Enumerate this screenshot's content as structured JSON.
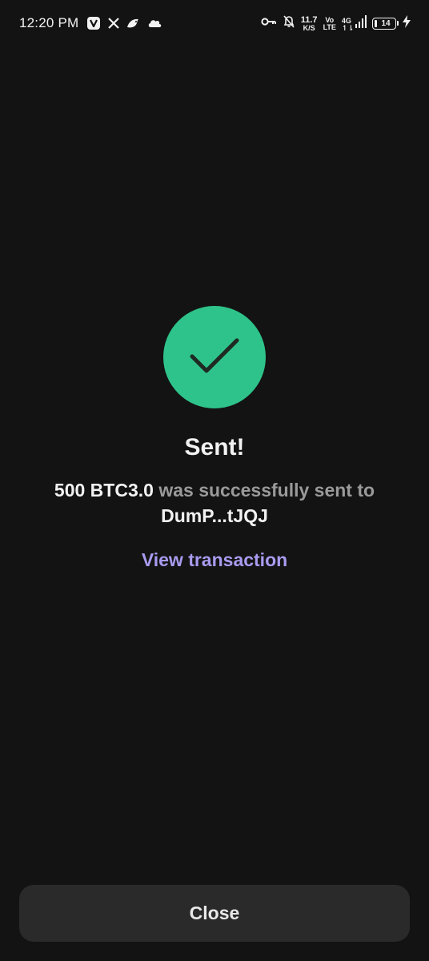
{
  "status_bar": {
    "time": "12:20 PM",
    "left_icons": [
      "vpn-v-icon",
      "x-icon",
      "bird-icon",
      "cloud-icon"
    ],
    "netspeed_value": "11.7",
    "netspeed_unit": "K/S",
    "volte_top": "Vo",
    "volte_bottom": "LTE",
    "network_gen": "4G",
    "battery_level": "14"
  },
  "result": {
    "icon": "checkmark-icon",
    "accent_color": "#2ec38a",
    "title": "Sent!",
    "amount": "500 BTC3.0",
    "message_middle": " was successfully sent to ",
    "recipient": "DumP...tJQJ",
    "link_label": "View transaction",
    "link_color": "#a99bf0"
  },
  "footer": {
    "close_label": "Close"
  }
}
